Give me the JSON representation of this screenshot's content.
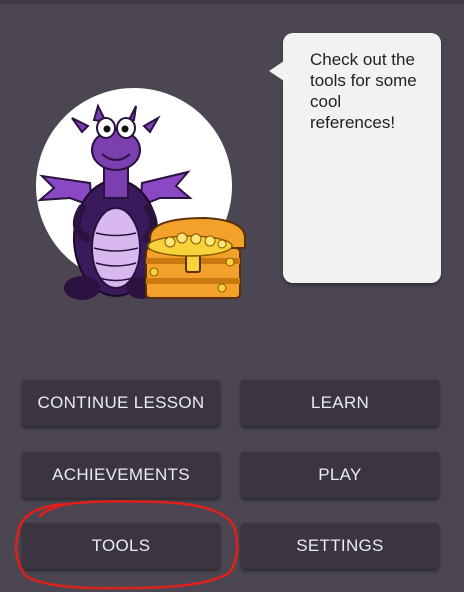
{
  "bubble": {
    "text": "Check out the tools for some cool references!"
  },
  "mascot": {
    "icon": "purple-dragon-with-treasure-chest",
    "colors": {
      "dragon": "#7b3fb0",
      "dragon_dark": "#2b1240",
      "belly": "#d9b8ef",
      "chest": "#f3a12a",
      "gold": "#f8d23a"
    }
  },
  "menu": {
    "continue_lesson": "CONTINUE LESSON",
    "learn": "LEARN",
    "achievements": "ACHIEVEMENTS",
    "play": "PLAY",
    "tools": "TOOLS",
    "settings": "SETTINGS"
  },
  "annotation": {
    "highlight_target": "tools-button",
    "color": "#e0201a"
  }
}
